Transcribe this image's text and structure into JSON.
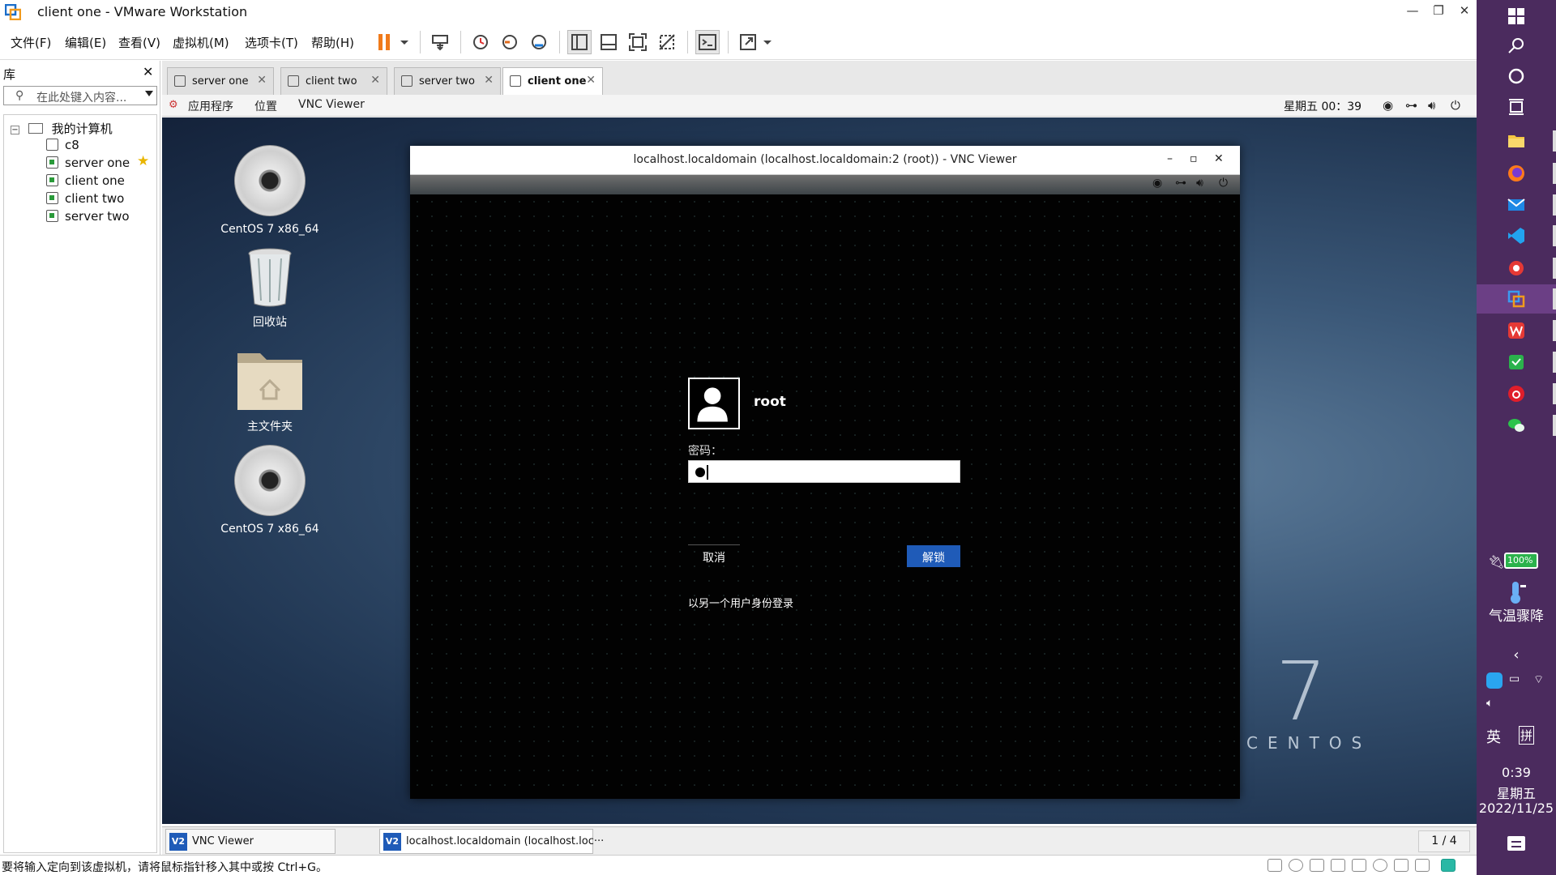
{
  "window": {
    "title": "client one - VMware Workstation",
    "controls": [
      "—",
      "❐",
      "✕"
    ]
  },
  "menu": [
    "文件(F)",
    "编辑(E)",
    "查看(V)",
    "虚拟机(M)",
    "选项卡(T)",
    "帮助(H)"
  ],
  "library": {
    "title": "库",
    "close": "✕",
    "search_placeholder": "在此处键入内容...",
    "root": "我的计算机",
    "items": [
      "c8",
      "server one",
      "client one",
      "client two",
      "server two"
    ],
    "favorite_marker": "★"
  },
  "tabs": [
    {
      "label": "server one",
      "active": false
    },
    {
      "label": "client two",
      "active": false
    },
    {
      "label": "server two",
      "active": false
    },
    {
      "label": "client one",
      "active": true
    }
  ],
  "guest": {
    "topbar": {
      "apps": "应用程序",
      "places": "位置",
      "current_app": "VNC Viewer",
      "clock": "星期五 00：39"
    },
    "desktop_icons": [
      "CentOS 7 x86_64",
      "回收站",
      "主文件夹",
      "CentOS 7 x86_64"
    ],
    "brand_number": "7",
    "brand_text": "CENTOS",
    "vnc": {
      "title": "localhost.localdomain (localhost.localdomain:2 (root)) - VNC Viewer",
      "controls": [
        "–",
        "▫",
        "✕"
      ],
      "lock": {
        "username": "root",
        "password_label": "密码：",
        "cancel": "取消",
        "unlock": "解锁",
        "other_user": "以另一个用户身份登录"
      }
    },
    "taskbar": {
      "items": [
        "VNC Viewer",
        "localhost.localdomain (localhost.loc···"
      ],
      "pager": "1 / 4"
    }
  },
  "statusbar": {
    "message": "要将输入定向到该虚拟机，请将鼠标指针移入其中或按 Ctrl+G。"
  },
  "windows_taskbar": {
    "battery": "100%",
    "weather": "气温骤降",
    "ime_lang": "英",
    "ime_mode": "拼",
    "time": "0:39",
    "weekday": "星期五",
    "date": "2022/11/25",
    "accent": "#4b2b5e"
  }
}
